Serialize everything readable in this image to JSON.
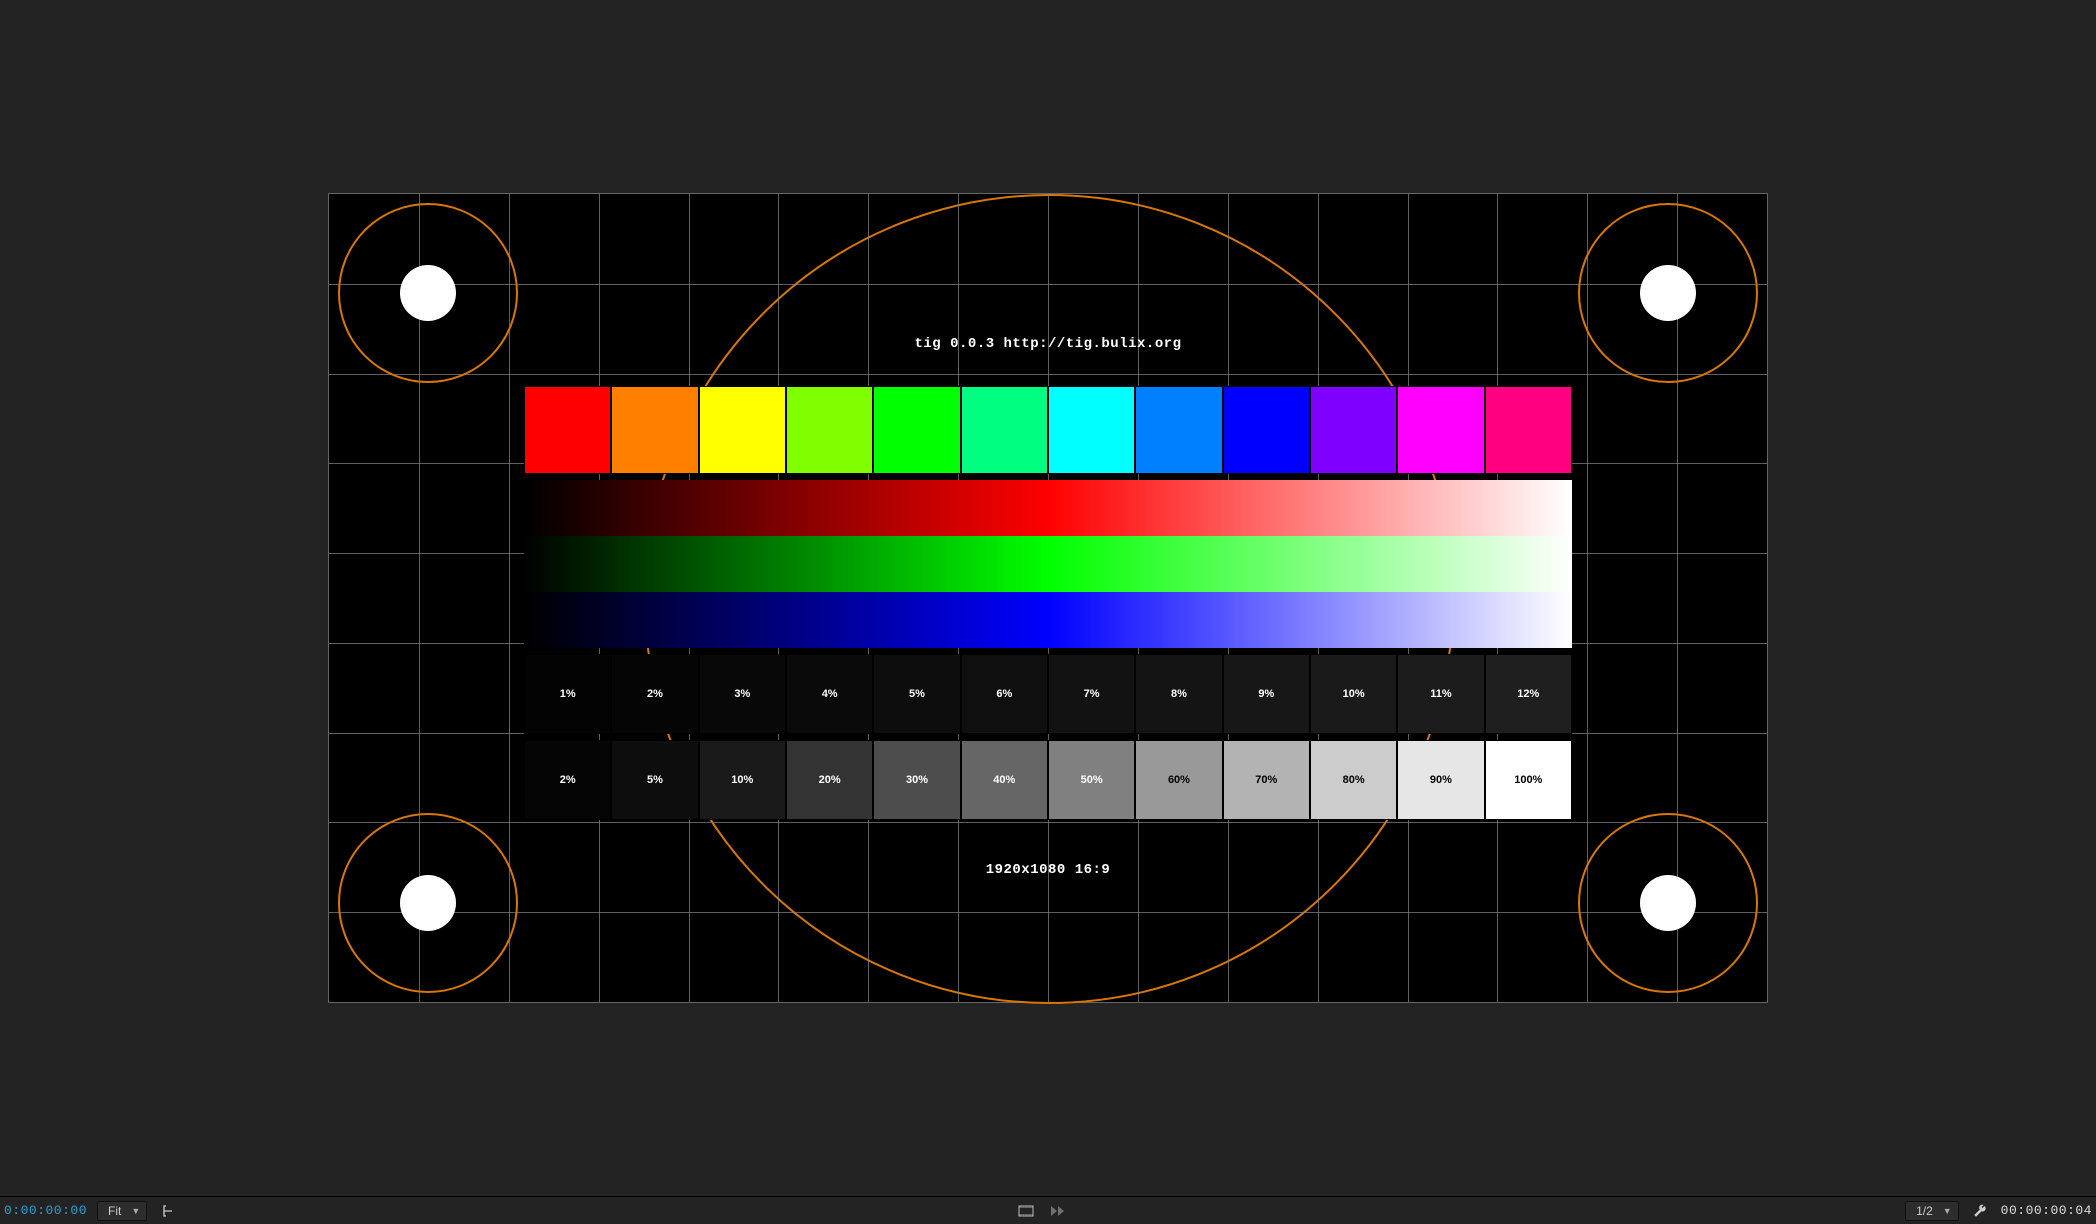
{
  "pattern": {
    "title_line": "tig 0.0.3  http://tig.bulix.org",
    "resolution_line": "1920x1080  16:9",
    "hue_swatches": [
      "#ff0000",
      "#ff8000",
      "#ffff00",
      "#80ff00",
      "#00ff00",
      "#00ff80",
      "#00ffff",
      "#0080ff",
      "#0000ff",
      "#8000ff",
      "#ff00ff",
      "#ff0080"
    ],
    "dark_steps": {
      "labels": [
        "1%",
        "2%",
        "3%",
        "4%",
        "5%",
        "6%",
        "7%",
        "8%",
        "9%",
        "10%",
        "11%",
        "12%"
      ],
      "colors": [
        "#030303",
        "#050505",
        "#080808",
        "#0a0a0a",
        "#0d0d0d",
        "#0f0f0f",
        "#121212",
        "#141414",
        "#171717",
        "#1a1a1a",
        "#1c1c1c",
        "#1f1f1f"
      ]
    },
    "gray_steps": {
      "labels": [
        "2%",
        "5%",
        "10%",
        "20%",
        "30%",
        "40%",
        "50%",
        "60%",
        "70%",
        "80%",
        "90%",
        "100%"
      ],
      "colors": [
        "#050505",
        "#0d0d0d",
        "#1a1a1a",
        "#333333",
        "#4d4d4d",
        "#666666",
        "#808080",
        "#999999",
        "#b3b3b3",
        "#cccccc",
        "#e6e6e6",
        "#ffffff"
      ],
      "text_colors": [
        "#fff",
        "#fff",
        "#fff",
        "#fff",
        "#fff",
        "#fff",
        "#fff",
        "#000",
        "#000",
        "#000",
        "#000",
        "#000"
      ]
    }
  },
  "toolbar": {
    "timecode_in": "0:00:00:00",
    "zoom_label": "Fit",
    "resolution_label": "1/2",
    "timecode_out": "00:00:00:04"
  }
}
